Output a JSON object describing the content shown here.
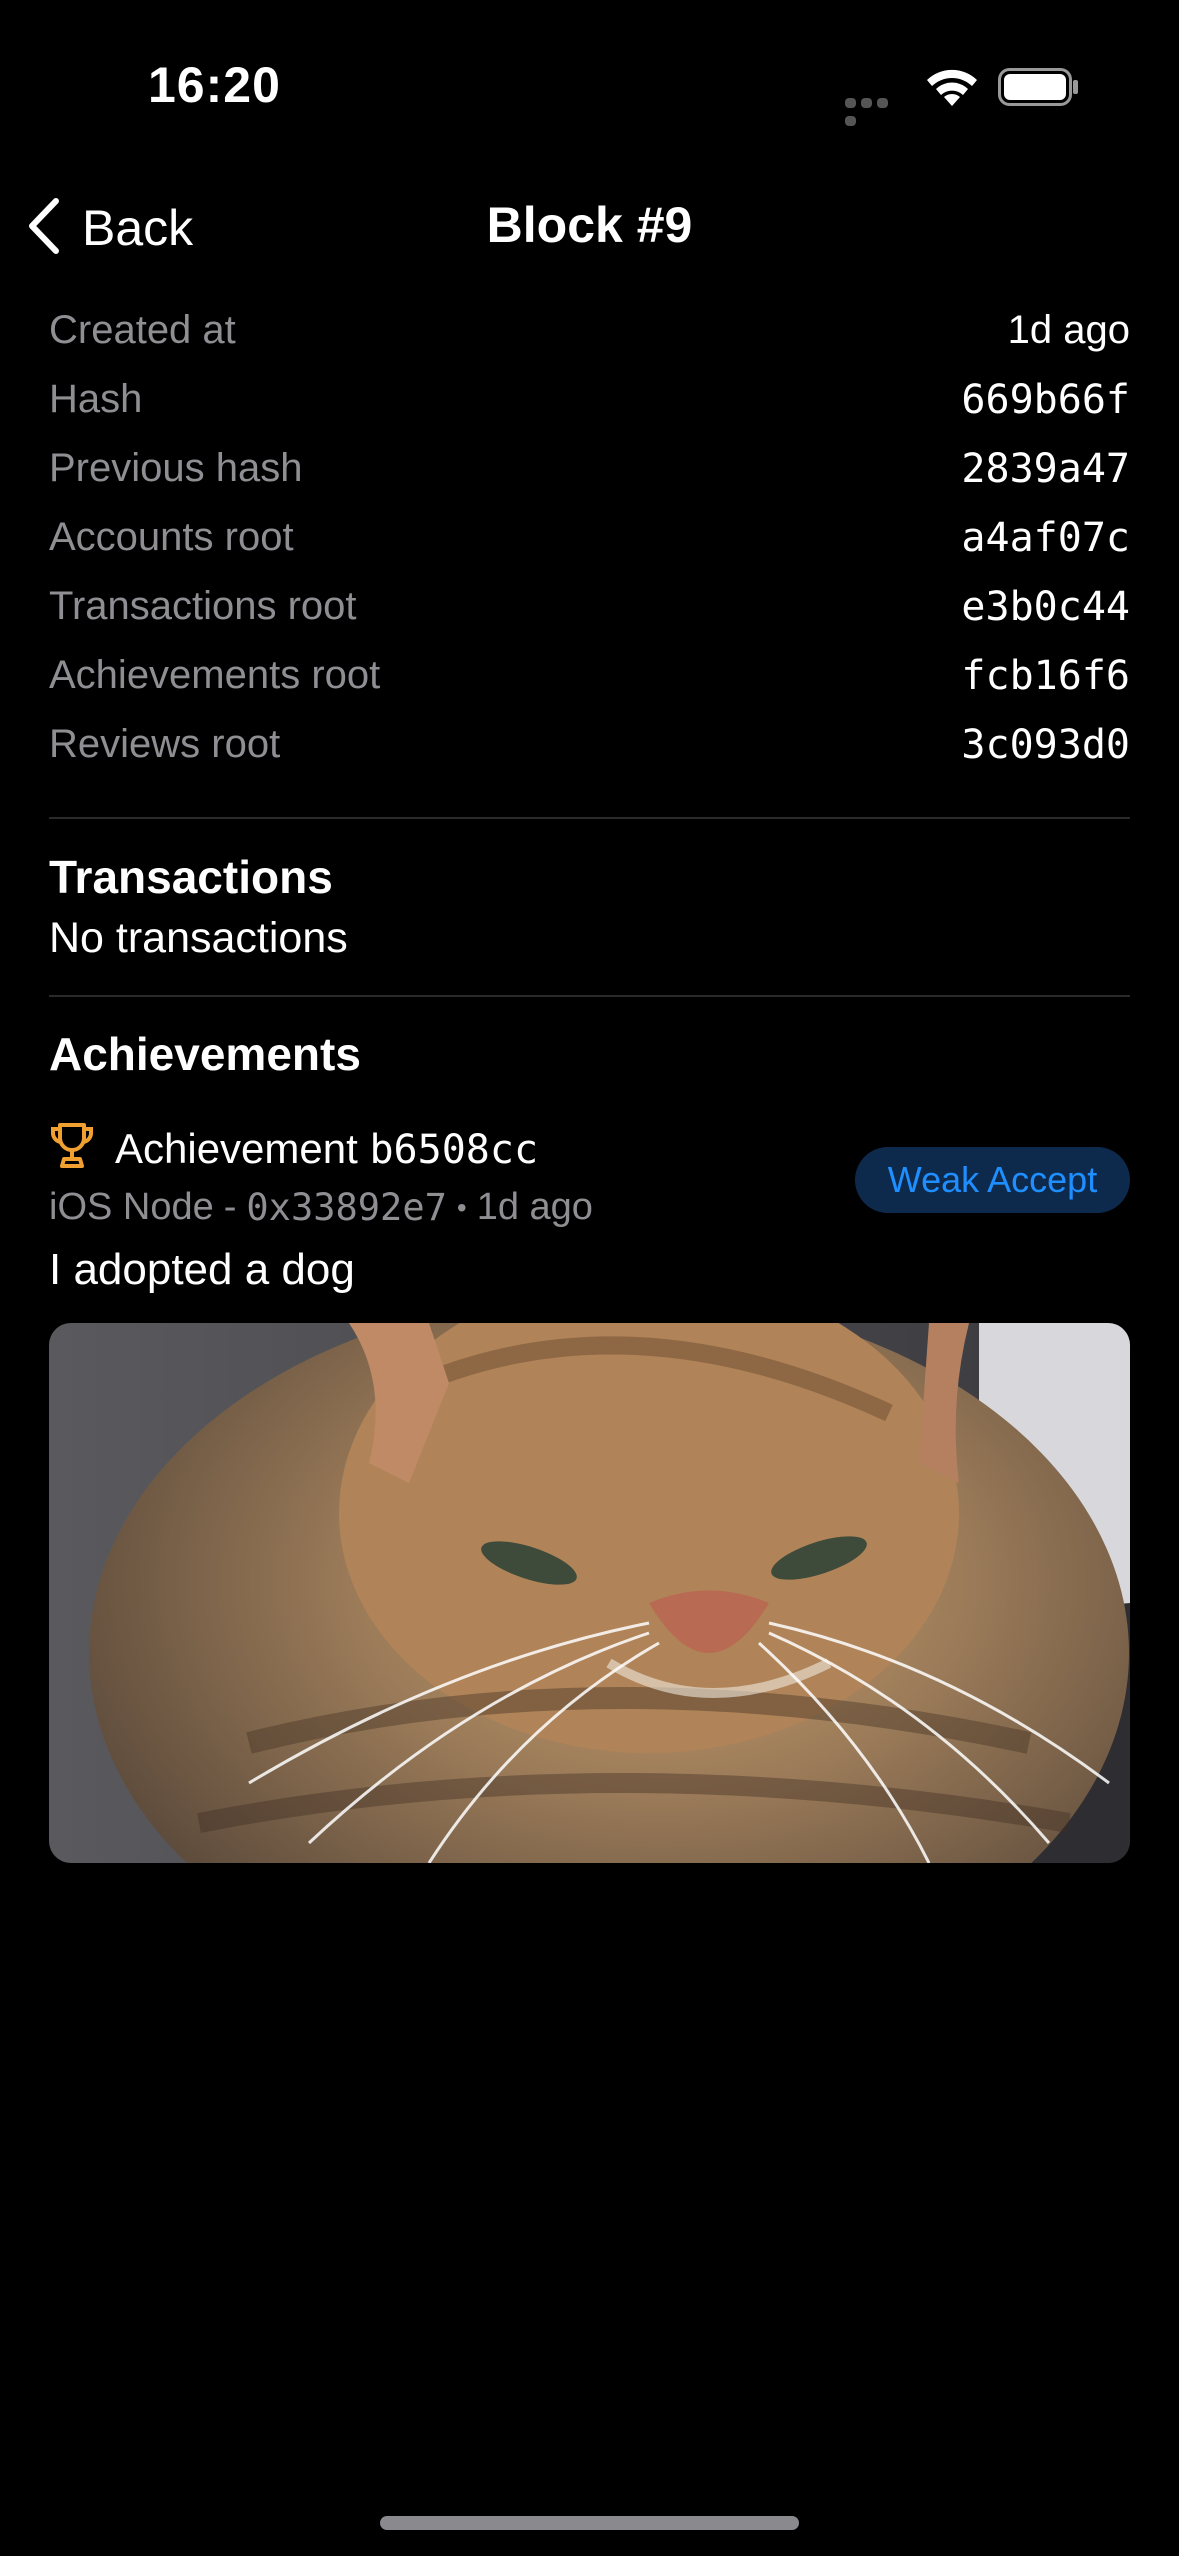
{
  "status_bar": {
    "time": "16:20"
  },
  "nav": {
    "back_label": "Back",
    "title": "Block #9"
  },
  "block_info": [
    {
      "label": "Created at",
      "value": "1d ago"
    },
    {
      "label": "Hash",
      "value": "669b66f"
    },
    {
      "label": "Previous hash",
      "value": "2839a47"
    },
    {
      "label": "Accounts root",
      "value": "a4af07c"
    },
    {
      "label": "Transactions root",
      "value": "e3b0c44"
    },
    {
      "label": "Achievements root",
      "value": "fcb16f6"
    },
    {
      "label": "Reviews root",
      "value": "3c093d0"
    }
  ],
  "transactions": {
    "title": "Transactions",
    "empty_text": "No transactions"
  },
  "achievements": {
    "title": "Achievements",
    "items": [
      {
        "icon": "trophy-icon",
        "title_prefix": "Achievement",
        "title_id": "b6508cc",
        "node": "iOS Node",
        "node_sep": "-",
        "address": "0x33892e7",
        "dot": "•",
        "time": "1d ago",
        "badge": "Weak Accept",
        "description": "I adopted a dog",
        "image": "cat-photo"
      }
    ]
  },
  "colors": {
    "background": "#000000",
    "secondary_text": "#8e8e93",
    "badge_bg": "#0d2a4d",
    "badge_text": "#1f8fff",
    "trophy": "#f0a030"
  }
}
